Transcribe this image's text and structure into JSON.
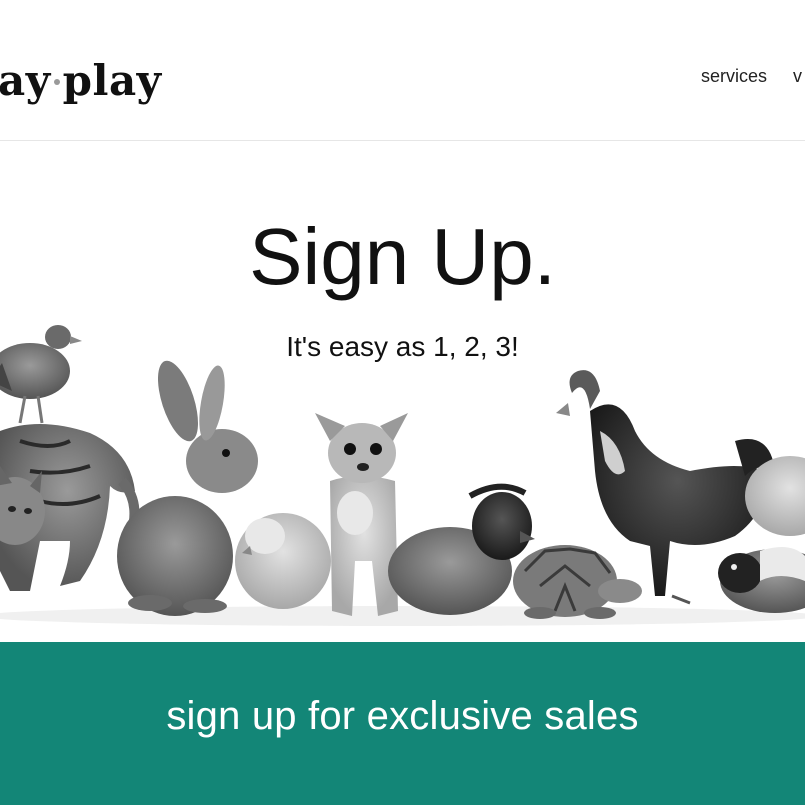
{
  "header": {
    "logo_left": "ay",
    "logo_right": "play",
    "nav": {
      "services": "services",
      "partial_item": "v"
    }
  },
  "hero": {
    "title": "Sign Up.",
    "subtitle": "It's easy as 1, 2, 3!",
    "image_subjects": [
      "chicken",
      "cat",
      "rabbit",
      "silkie-chick",
      "chihuahua",
      "silkie-hen",
      "tortoise",
      "rooster",
      "guinea-pig"
    ]
  },
  "banner": {
    "text": "sign up for exclusive sales",
    "color": "#138677"
  }
}
